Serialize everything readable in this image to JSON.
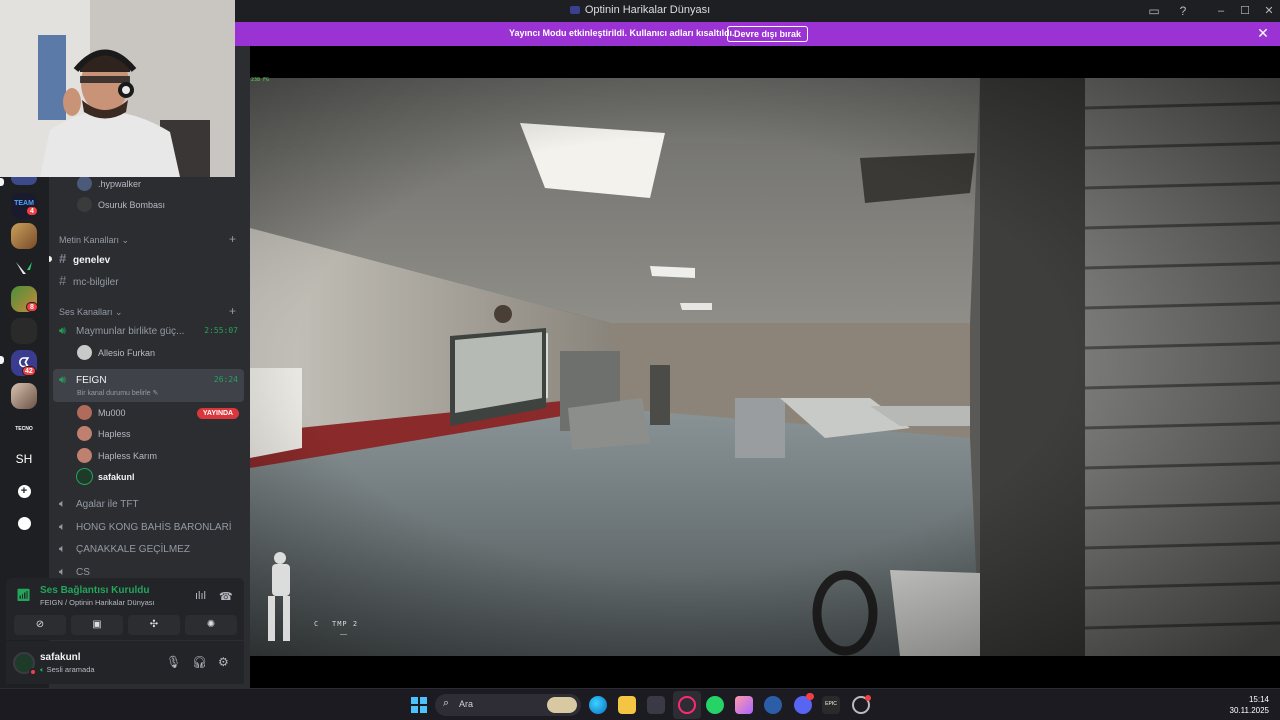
{
  "window": {
    "title": "Optinin Harikalar Dünyası"
  },
  "banner": {
    "message": "Yayıncı Modu etkinleştirildi. Kullanıcı adları kısaltıldı.",
    "button": "Devre dışı bırak"
  },
  "rail": {
    "badges": [
      "4",
      "8",
      "42"
    ],
    "text_server": "SH",
    "logo_text": "TEAM",
    "logo_text2": "TECNO"
  },
  "channels": {
    "top_members": [
      ".hypwalker",
      "Osuruk Bombası"
    ],
    "text_section": "Metin Kanalları",
    "text_channels": [
      "genelev",
      "mc-bilgiler"
    ],
    "voice_section": "Ses Kanalları",
    "voice_channels": [
      {
        "name": "Maymunlar birlikte güç...",
        "timer": "2:55:07"
      },
      {
        "name": "FEIGN",
        "timer": "26:24",
        "status": "Bir kanal durumu belirle"
      }
    ],
    "first_members": [
      "Allesio Furkan"
    ],
    "feign_members": [
      "Mu000",
      "Hapless",
      "Hapless Karım",
      "safakunl"
    ],
    "live_badge": "YAYINDA",
    "other_voice": [
      "Agalar ile TFT",
      "HONG KONG BAHİS BARONLARİ",
      "ÇANAKKALE GEÇİLMEZ",
      "CS"
    ]
  },
  "voice_panel": {
    "status": "Ses Bağlantısı Kuruldu",
    "location": "FEIGN / Optinin Harikalar Dünyası"
  },
  "user": {
    "name": "safakunl",
    "status": "Sesli aramada"
  },
  "game": {
    "fps": "238 FG",
    "hud_text": "TMP 2",
    "hud_letter": "C",
    "ammo": "—"
  },
  "taskbar": {
    "search_placeholder": "Ara",
    "time": "15:14",
    "date": "30.11.2025"
  },
  "colors": {
    "banner": "#9b33d4",
    "green": "#23a55a",
    "live": "#da373c",
    "sidebar": "#2b2d31"
  }
}
